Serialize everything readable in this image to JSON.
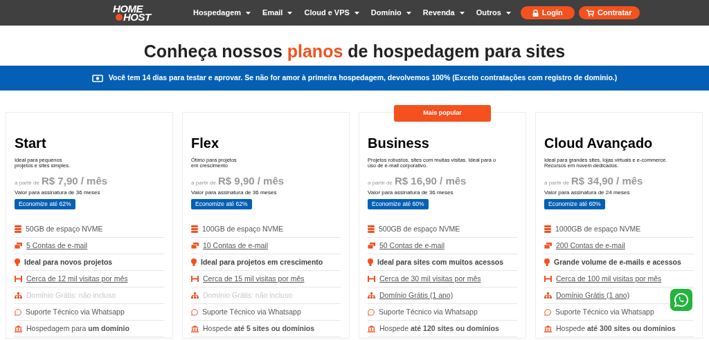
{
  "logo": {
    "line1": "HOME",
    "line2": "HOST"
  },
  "nav": [
    {
      "label": "Hospedagem"
    },
    {
      "label": "Email"
    },
    {
      "label": "Cloud e VPS"
    },
    {
      "label": "Domínio"
    },
    {
      "label": "Revenda"
    },
    {
      "label": "Outros"
    }
  ],
  "actions": [
    {
      "label": "Login",
      "kind": "lock"
    },
    {
      "label": "Contratar",
      "kind": "cart"
    }
  ],
  "heading": {
    "before": "Conheça nossos",
    "highlight": "planos",
    "after": "de hospedagem para sites"
  },
  "banner": "Você tem 14 dias para testar e aprovar. Se não for amor à primeira hospedagem, devolvemos 100% (Exceto contratações com registro de dominio.)",
  "plans": [
    {
      "name": "Start",
      "description": [
        "Ideal para pequenos",
        "projetos e sites simples."
      ],
      "price_prefix": "a partir de",
      "price": "R$ 7,90 / mês",
      "term": "Valor para assinatura de 36 meses",
      "discount": "Economize até 62%",
      "features": [
        {
          "kind": "storage",
          "text": "50GB de espaço NVME",
          "link": false,
          "disabled": false
        },
        {
          "kind": "email",
          "text": "5 Contas de e-mail",
          "link": true,
          "disabled": false
        },
        {
          "kind": "idea",
          "text": "Ideal para novos projetos",
          "link": false,
          "disabled": false
        },
        {
          "kind": "visits",
          "text": "Cerca de 12 mil visitas por mês",
          "link": true,
          "disabled": false
        },
        {
          "kind": "domain",
          "text": "Domínio Grátis: não incluso",
          "link": false,
          "disabled": true
        },
        {
          "kind": "support",
          "text": "Suporte Técnico via Whatsapp",
          "link": false,
          "disabled": false
        },
        {
          "kind": "hosting",
          "text": "Hospedagem para **um domínio**",
          "link": false,
          "disabled": false
        }
      ]
    },
    {
      "name": "Flex",
      "description": [
        "Ótimo para projetos",
        "em crescimento"
      ],
      "price_prefix": "a partir de",
      "price": "R$ 9,90 / mês",
      "term": "Valor para assinatura de 36 meses",
      "discount": "Economize até 62%",
      "features": [
        {
          "kind": "storage",
          "text": "100GB de espaço NVME",
          "link": false,
          "disabled": false
        },
        {
          "kind": "email",
          "text": "10 Contas de e-mail",
          "link": true,
          "disabled": false
        },
        {
          "kind": "idea",
          "text": "Ideal para projetos em crescimento",
          "link": false,
          "disabled": false
        },
        {
          "kind": "visits",
          "text": "Cerca de 15 mil visitas por mês",
          "link": true,
          "disabled": false
        },
        {
          "kind": "domain",
          "text": "Domínio Grátis: não incluso",
          "link": false,
          "disabled": true
        },
        {
          "kind": "support",
          "text": "Suporte Técnico via Whatsapp",
          "link": false,
          "disabled": false
        },
        {
          "kind": "hosting",
          "text": "Hospede **até 5 sites ou domínios**",
          "link": false,
          "disabled": false
        }
      ]
    },
    {
      "name": "Business",
      "popular_badge": "Mais popular",
      "description": [
        "Projetos robustos, sites com muitas visitas. Ideal para o",
        "uso de e-mail corporativo."
      ],
      "price_prefix": "a partir de",
      "price": "R$ 16,90 / mês",
      "term": "Valor para assinatura de 36 meses",
      "discount": "Economize até 60%",
      "features": [
        {
          "kind": "storage",
          "text": "500GB de espaço NVME",
          "link": false,
          "disabled": false
        },
        {
          "kind": "email",
          "text": "50 Contas de e-mail",
          "link": true,
          "disabled": false
        },
        {
          "kind": "idea",
          "text": "Ideal para sites com muitos acessos",
          "link": false,
          "disabled": false
        },
        {
          "kind": "visits",
          "text": "Cerca de 30 mil visitas por mês",
          "link": true,
          "disabled": false
        },
        {
          "kind": "domain",
          "text": "Domínio Grátis (1 ano)",
          "link": true,
          "disabled": false
        },
        {
          "kind": "support",
          "text": "Suporte Técnico via Whatsapp",
          "link": false,
          "disabled": false
        },
        {
          "kind": "hosting",
          "text": "Hospede **até 120 sites ou domínios**",
          "link": false,
          "disabled": false
        }
      ]
    },
    {
      "name": "Cloud Avançado",
      "description": [
        "Ideal para grandes sites, lojas virtuais e e-commerce.",
        "Recursos em nuvem dedicados."
      ],
      "price_prefix": "a partir de",
      "price": "R$ 34,90 / mês",
      "term": "Valor para assinatura de 24 meses",
      "discount": "Economize até 60%",
      "features": [
        {
          "kind": "storage",
          "text": "1000GB de espaço NVME",
          "link": false,
          "disabled": false
        },
        {
          "kind": "email",
          "text": "200 Contas de e-mail",
          "link": true,
          "disabled": false
        },
        {
          "kind": "idea",
          "text": "Grande volume de e-mails e acessos",
          "link": false,
          "disabled": false
        },
        {
          "kind": "visits",
          "text": "Cerca de 100 mil visitas por mês",
          "link": true,
          "disabled": false
        },
        {
          "kind": "domain",
          "text": "Domínio Grátis (1 ano)",
          "link": true,
          "disabled": false
        },
        {
          "kind": "support",
          "text": "Suporte Técnico via Whatsapp",
          "link": false,
          "disabled": false
        },
        {
          "kind": "hosting",
          "text": "Hospede **até 300 sites ou domínios**",
          "link": false,
          "disabled": false
        }
      ]
    }
  ]
}
